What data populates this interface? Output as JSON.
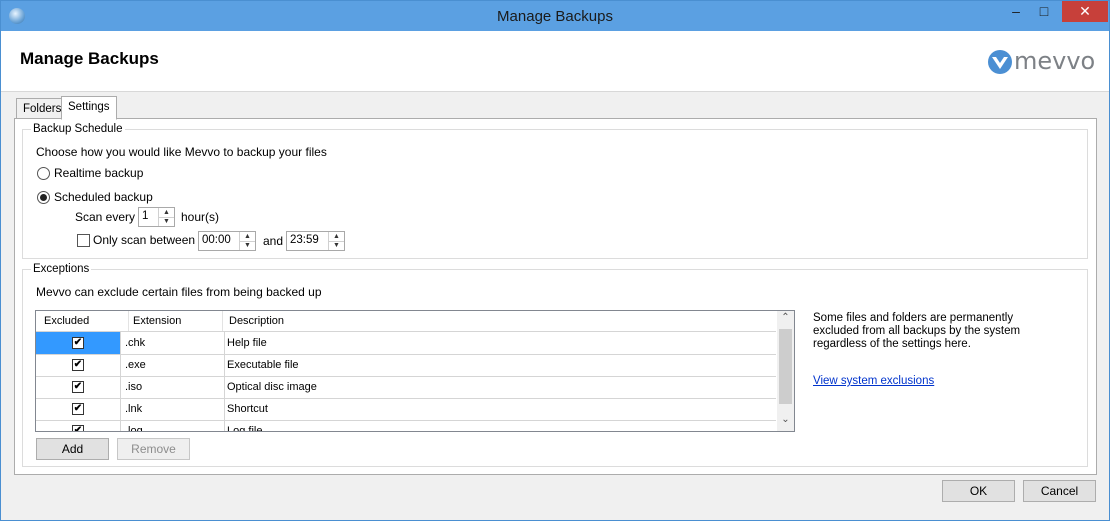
{
  "window": {
    "title": "Manage Backups",
    "minimize": "–",
    "maximize": "□",
    "close": "✕"
  },
  "header": {
    "title": "Manage Backups",
    "logo_text": "mevvo"
  },
  "tabs": [
    {
      "label": "Folders",
      "active": false
    },
    {
      "label": "Settings",
      "active": true
    }
  ],
  "backup_schedule": {
    "legend": "Backup Schedule",
    "description": "Choose how you would like Mevvo to backup your files",
    "realtime_label": "Realtime backup",
    "realtime_selected": false,
    "scheduled_label": "Scheduled backup",
    "scheduled_selected": true,
    "scan_every_label": "Scan every",
    "scan_every_value": "1",
    "scan_unit_label": "hour(s)",
    "only_scan_label": "Only scan between",
    "only_scan_checked": false,
    "start_time": "00:00",
    "and_label": "and",
    "end_time": "23:59"
  },
  "exceptions": {
    "legend": "Exceptions",
    "description": "Mevvo can exclude certain files from being backed up",
    "columns": [
      "Excluded",
      "Extension",
      "Description"
    ],
    "rows": [
      {
        "excluded": true,
        "extension": ".chk",
        "description": "Help file"
      },
      {
        "excluded": true,
        "extension": ".exe",
        "description": "Executable file"
      },
      {
        "excluded": true,
        "extension": ".iso",
        "description": "Optical disc image"
      },
      {
        "excluded": true,
        "extension": ".lnk",
        "description": "Shortcut"
      },
      {
        "excluded": true,
        "extension": ".log",
        "description": "Log file"
      }
    ],
    "add_label": "Add",
    "remove_label": "Remove",
    "side_note": "Some files and folders are permanently excluded from all backups by the system regardless of the settings here.",
    "view_link": "View system exclusions"
  },
  "footer": {
    "ok_label": "OK",
    "cancel_label": "Cancel"
  },
  "colors": {
    "titlebar": "#5ba0e2",
    "close": "#c7403a",
    "selection": "#3399ff",
    "link": "#0033cc"
  }
}
